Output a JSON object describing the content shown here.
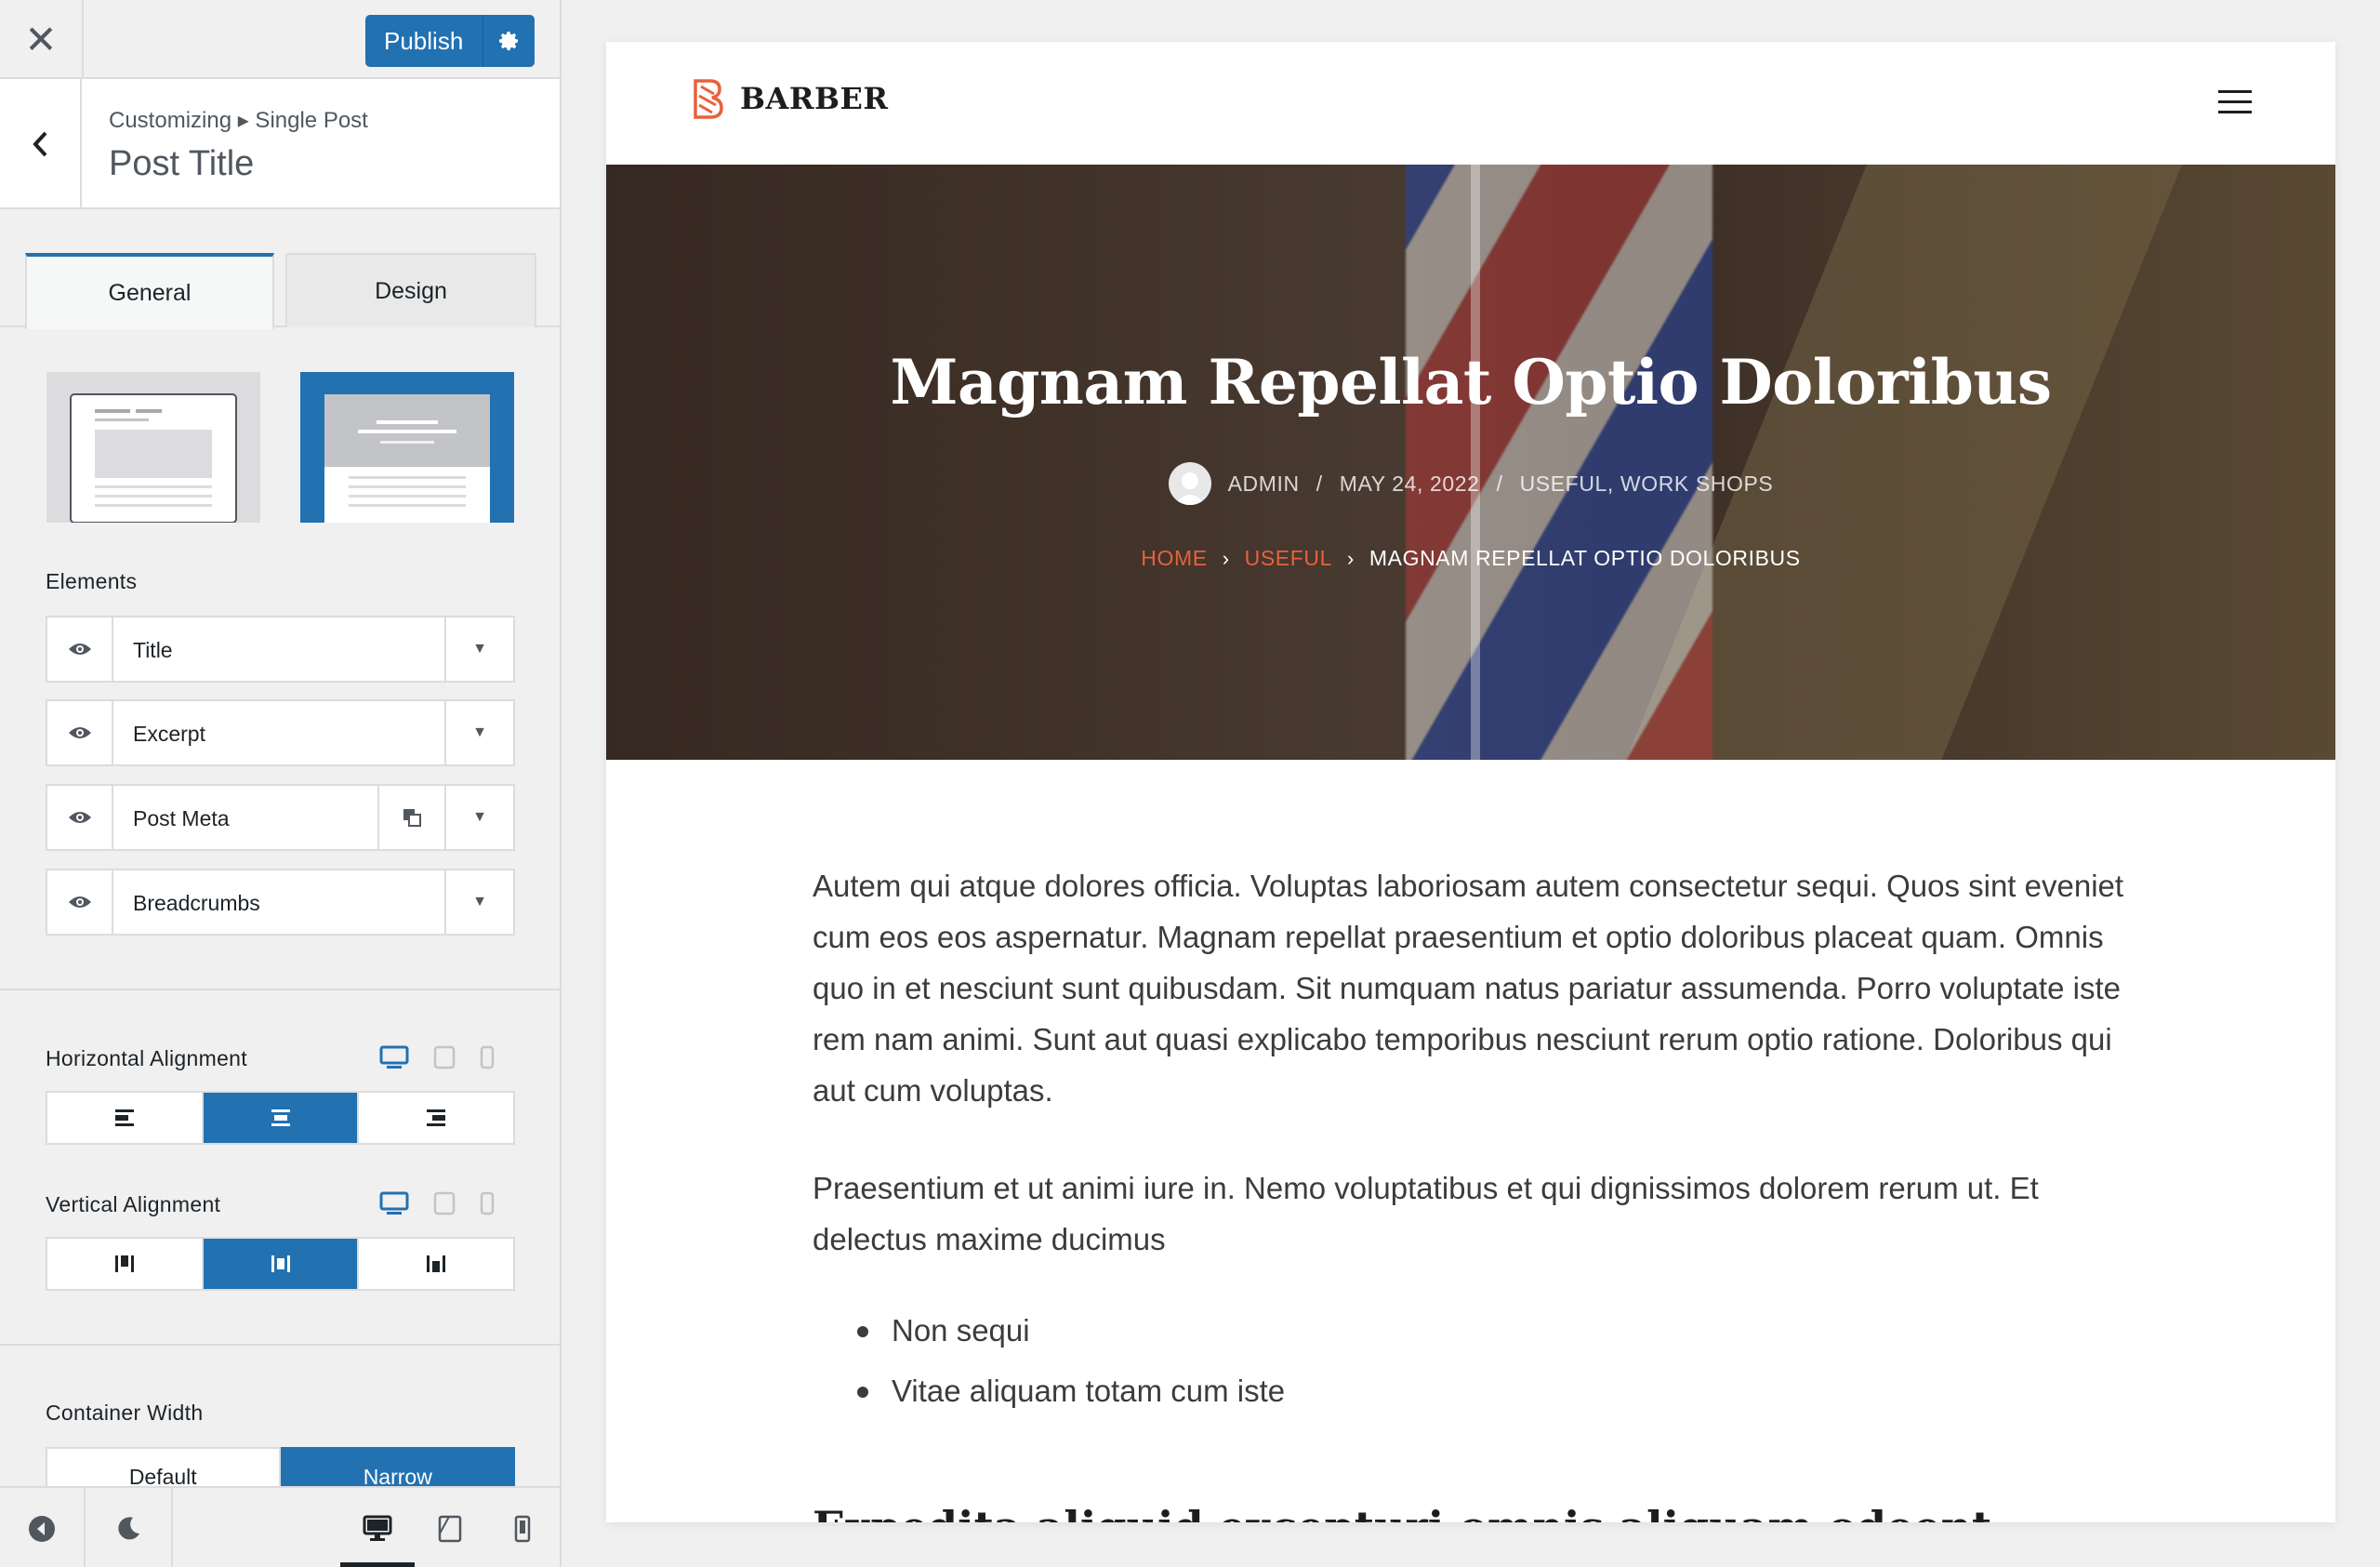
{
  "topbar": {
    "publish_label": "Publish"
  },
  "panel": {
    "breadcrumb": "Customizing ▸ Single Post",
    "title": "Post Title"
  },
  "tabs": [
    {
      "label": "General",
      "active": true
    },
    {
      "label": "Design",
      "active": false
    }
  ],
  "layout_options": {
    "selected": 2
  },
  "elements": {
    "label": "Elements",
    "items": [
      {
        "label": "Title"
      },
      {
        "label": "Excerpt"
      },
      {
        "label": "Post Meta"
      },
      {
        "label": "Breadcrumbs"
      }
    ]
  },
  "horizontal_alignment": {
    "label": "Horizontal Alignment",
    "selected": "center"
  },
  "vertical_alignment": {
    "label": "Vertical Alignment",
    "selected": "center"
  },
  "container_width": {
    "label": "Container Width",
    "options": [
      "Default",
      "Narrow"
    ],
    "selected": "Narrow"
  },
  "colors": {
    "accent": "#2271b1",
    "link": "#e8613c"
  },
  "site": {
    "logo_text": "BARBER",
    "hero": {
      "title": "Magnam Repellat Optio Doloribus",
      "meta_author": "ADMIN",
      "meta_sep": "/",
      "meta_date": "MAY 24, 2022",
      "meta_categories": "USEFUL, WORK SHOPS",
      "crumb_home": "HOME",
      "crumb_cat": "USEFUL",
      "crumb_current": "MAGNAM REPELLAT OPTIO DOLORIBUS"
    },
    "paragraphs": [
      "Autem qui atque dolores officia. Voluptas laboriosam autem consectetur sequi. Quos sint eveniet cum eos eos aspernatur. Magnam repellat praesentium et optio doloribus placeat quam. Omnis quo in et nesciunt sunt quibusdam. Sit numquam natus pariatur assumenda. Porro voluptate iste rem nam animi. Sunt aut quasi explicabo temporibus nesciunt rerum optio ratione. Doloribus qui aut cum voluptas.",
      "Praesentium et ut animi iure in. Nemo voluptatibus et qui dignissimos dolorem rerum ut. Et delectus maxime ducimus"
    ],
    "list": [
      "Non sequi",
      "Vitae aliquam totam cum iste"
    ],
    "next_heading": "Expedita aliquid excepturi omnis aliquam odeent"
  }
}
